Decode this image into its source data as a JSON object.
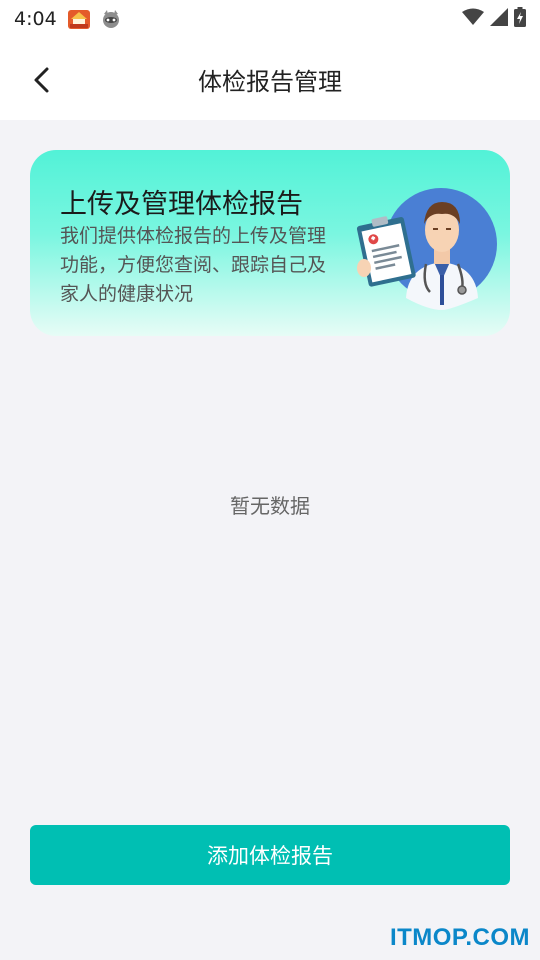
{
  "status_bar": {
    "time": "4:04",
    "app_icons": [
      "hub-app-icon",
      "raccoon-app-icon"
    ],
    "system_icons": [
      "wifi-icon",
      "signal-icon",
      "battery-charging-icon"
    ]
  },
  "nav": {
    "title": "体检报告管理",
    "back_icon": "chevron-left-icon"
  },
  "banner": {
    "title": "上传及管理体检报告",
    "description": "我们提供体检报告的上传及管理功能，方便您查阅、跟踪自己及家人的健康状况",
    "illustration": "doctor-with-clipboard"
  },
  "empty_state": {
    "text": "暂无数据"
  },
  "actions": {
    "add_report_label": "添加体检报告"
  },
  "watermark": "ITMOP.COM",
  "colors": {
    "accent": "#00bfb3",
    "banner_gradient_top": "#52f2d7",
    "banner_gradient_bottom": "#e7fcf6",
    "background": "#f3f3f7",
    "watermark": "#0b87c9"
  }
}
